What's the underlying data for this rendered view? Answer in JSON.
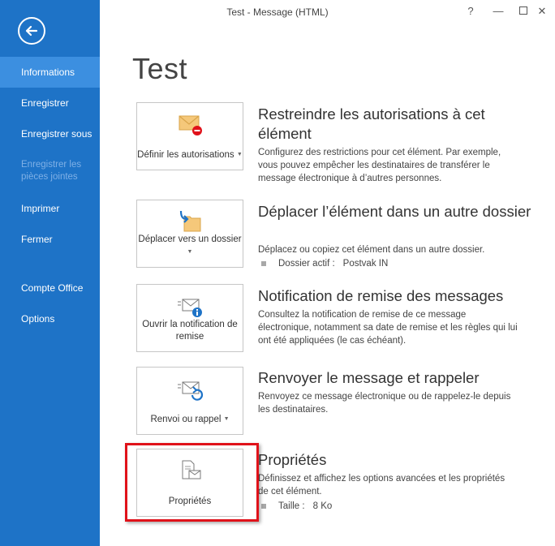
{
  "window": {
    "title": "Test - Message (HTML)",
    "help": "?",
    "minimize": "—",
    "close": "✕"
  },
  "sidebar": {
    "items": [
      {
        "label": "Informations"
      },
      {
        "label": "Enregistrer"
      },
      {
        "label": "Enregistrer sous"
      },
      {
        "label": "Enregistrer les pièces jointes"
      },
      {
        "label": "Imprimer"
      },
      {
        "label": "Fermer"
      },
      {
        "label": "Compte Office"
      },
      {
        "label": "Options"
      }
    ]
  },
  "page": {
    "title": "Test"
  },
  "sections": [
    {
      "button": "Définir les autorisations",
      "title": "Restreindre les autorisations à cet élément",
      "desc": "Configurez des restrictions pour cet élément. Par exemple, vous pouvez empêcher les destinataires de transférer le message électronique à d’autres personnes."
    },
    {
      "button": "Déplacer vers un dossier",
      "title": "Déplacer l’élément dans un autre dossier",
      "desc": "Déplacez ou copiez cet élément dans un autre dossier.",
      "prop_label": "Dossier actif :",
      "prop_value": "Postvak IN"
    },
    {
      "button": "Ouvrir la notification de remise",
      "title": "Notification de remise des messages",
      "desc": "Consultez la notification de remise de ce message électronique, notamment sa date de remise et les règles qui lui ont été appliquées (le cas échéant)."
    },
    {
      "button": "Renvoi ou rappel",
      "title": "Renvoyer le message et rappeler",
      "desc": "Renvoyez ce message électronique ou de rappelez-le depuis les destinataires."
    },
    {
      "button": "Propriétés",
      "title": "Propriétés",
      "desc": "Définissez et affichez les options avancées et les propriétés de cet élément.",
      "prop_label": "Taille :",
      "prop_value": "8 Ko"
    }
  ],
  "colors": {
    "sidebar": "#1e73c7",
    "sidebar_active": "#3c8fe0",
    "highlight": "#e0121a"
  }
}
